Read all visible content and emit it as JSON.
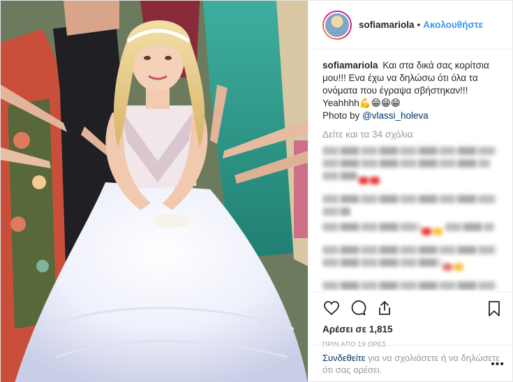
{
  "post": {
    "username": "sofiamariola",
    "separator": "•",
    "follow_label": "Ακολουθήστε",
    "caption": {
      "username": "sofiamariola",
      "text": "Και στα δικά σας κορίτσια μου!!! Ενα έχω να δηλώσω ότι όλα τα ονόματα που έγραψα σβήστηκαν!!! Yeahhhh💪😁😁😁",
      "photo_by_label": "Photo by ",
      "photo_by_mention": "@vlassi_holeva"
    },
    "view_all_comments": "Δείτε και τα 34 σχόλια",
    "likes_text": "Αρέσει σε 1,815",
    "timestamp": "ΠΡΙΝ ΑΠΟ 19 ΩΡΕΣ",
    "login": {
      "link": "Συνδεθείτε",
      "text": " για να σχολιάσετε ή να δηλώσετε ότι σας αρέσει."
    },
    "more_label": "•••"
  },
  "icons": {
    "like": "heart-icon",
    "comment": "comment-bubble-icon",
    "share": "share-upload-icon",
    "save": "bookmark-icon",
    "more": "more-options-icon"
  },
  "colors": {
    "follow": "#3897f0",
    "link": "#003569",
    "muted": "#999999",
    "text": "#262626",
    "border": "#efefef"
  }
}
